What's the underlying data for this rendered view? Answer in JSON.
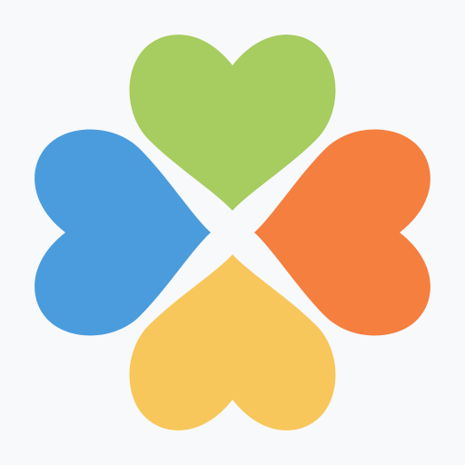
{
  "app_icon": {
    "name": "four-heart-clover-icon",
    "background_color": "#f8f9fb",
    "hearts": [
      {
        "name": "top-heart-green",
        "color": "#a7cc5f"
      },
      {
        "name": "right-heart-orange",
        "color": "#f47f3f"
      },
      {
        "name": "bottom-heart-yellow",
        "color": "#f8c75b"
      },
      {
        "name": "left-heart-blue",
        "color": "#4a9cdd"
      }
    ]
  }
}
